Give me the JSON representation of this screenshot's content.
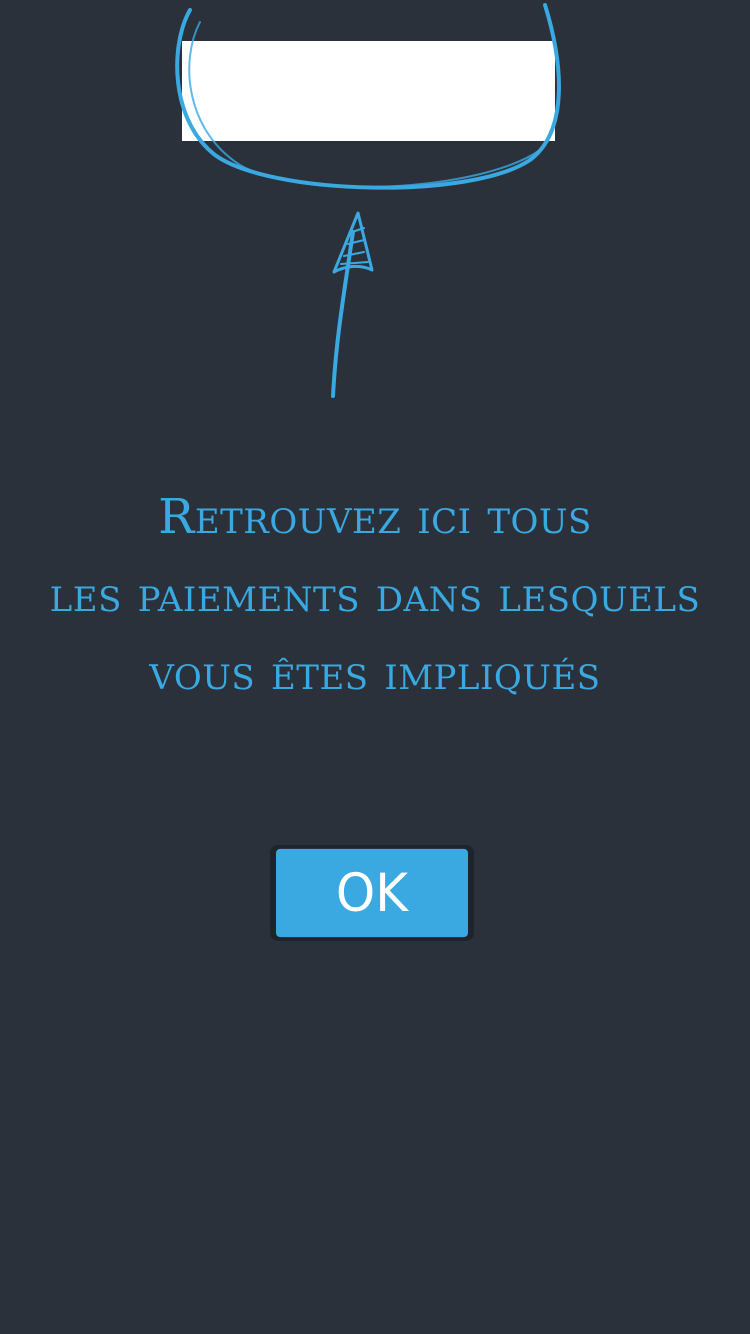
{
  "coach_mark": {
    "message_lines": [
      "Retrouvez ici tous",
      "les paiements dans lesquels",
      "vous êtes impliqués"
    ],
    "ok_label": "OK"
  },
  "colors": {
    "background": "#2a313b",
    "accent": "#3aa9e2",
    "button_text": "#ffffff",
    "highlight": "#ffffff"
  }
}
